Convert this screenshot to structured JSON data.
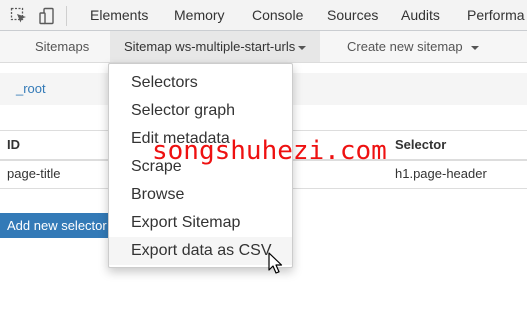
{
  "devtools": {
    "tabs": [
      "Elements",
      "Memory",
      "Console",
      "Sources",
      "Audits",
      "Performa"
    ]
  },
  "ws_nav": {
    "sitemaps": "Sitemaps",
    "current_sitemap": "Sitemap ws-multiple-start-urls",
    "create": "Create new sitemap"
  },
  "breadcrumb": {
    "root": "_root"
  },
  "table": {
    "headers": {
      "id": "ID",
      "selector": "Selector"
    },
    "rows": [
      {
        "id": "page-title",
        "selector": "h1.page-header"
      }
    ]
  },
  "add_button": "Add new selector",
  "dropdown": {
    "items": [
      "Selectors",
      "Selector graph",
      "Edit metadata",
      "Scrape",
      "Browse",
      "Export Sitemap",
      "Export data as CSV"
    ]
  },
  "watermark": "songshuhezi.com",
  "colors": {
    "link": "#337ab7",
    "primary_button": "#337ab7",
    "watermark": "#ee1111"
  }
}
